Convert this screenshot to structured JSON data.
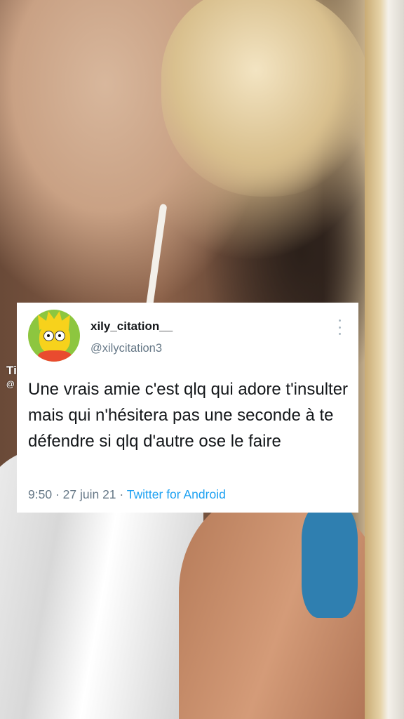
{
  "tweet": {
    "display_name": "xily_citation__",
    "handle": "@xilycitation3",
    "text": "Une vrais amie c'est qlq qui adore t'insulter mais qui n'hésitera pas une seconde à te défendre si qlq d'autre ose le faire",
    "time": "9:50",
    "separator": "·",
    "date": "27 juin 21",
    "source": "Twitter for Android",
    "more_icon": "more-vertical-icon",
    "avatar_icon": "cartoon-avatar-icon"
  },
  "overlay": {
    "partial_text_1": "Ti",
    "partial_text_2": "@"
  },
  "colors": {
    "card_bg": "#ffffff",
    "name": "#14171a",
    "secondary": "#657786",
    "link": "#1da1f2"
  }
}
